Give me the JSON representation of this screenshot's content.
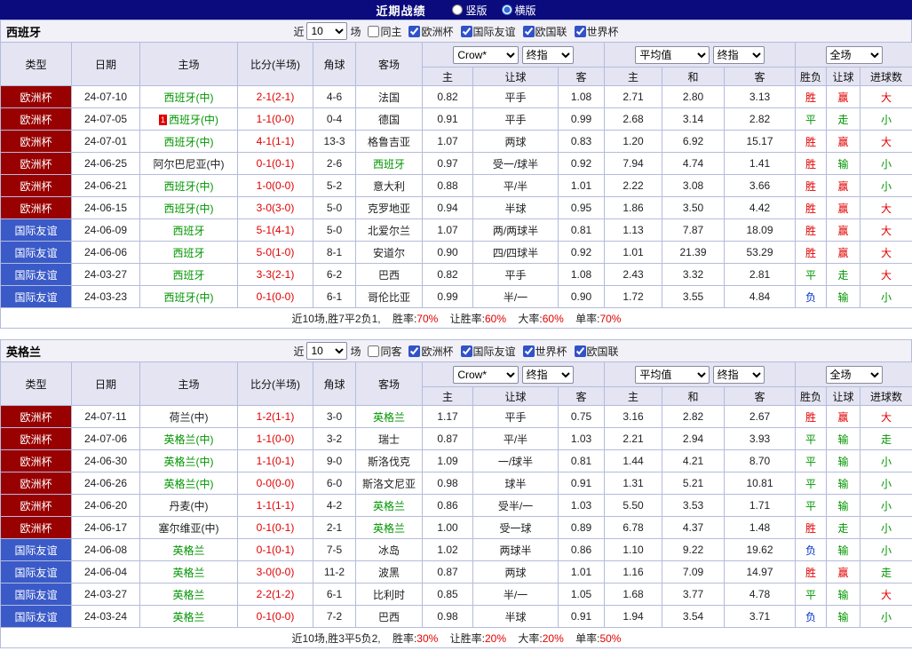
{
  "top_bar": {
    "title": "近期战绩",
    "options": [
      {
        "label": "竖版",
        "checked": false
      },
      {
        "label": "横版",
        "checked": true
      }
    ]
  },
  "colors": {
    "topbar_bg": "#0b0b7e",
    "euro_cup_bg": "#990000",
    "friendly_bg": "#3a5ac8",
    "header_bg": "#e4e4f2",
    "win_red": "#e00000",
    "draw_green": "#009500",
    "lose_blue": "#0033cc",
    "team_green": "#009500"
  },
  "header_labels": {
    "type": "类型",
    "date": "日期",
    "home": "主场",
    "score": "比分(半场)",
    "corner": "角球",
    "away": "客场",
    "crow": "Crow*",
    "final_index": "终指",
    "average": "平均值",
    "scope": "全场",
    "sub_home": "主",
    "sub_handicap": "让球",
    "sub_away": "客",
    "sub_draw": "和",
    "sub_result": "胜负",
    "sub_goals": "进球数"
  },
  "sections": [
    {
      "team": "西班牙",
      "filter": {
        "near": "近",
        "count": "10",
        "unit": "场",
        "same": {
          "label": "同主",
          "checked": false
        },
        "competitions": [
          {
            "label": "欧洲杯",
            "checked": true
          },
          {
            "label": "国际友谊",
            "checked": true
          },
          {
            "label": "欧国联",
            "checked": true
          },
          {
            "label": "世界杯",
            "checked": true
          }
        ]
      },
      "rows": [
        {
          "type": "欧洲杯",
          "type_style": "euro",
          "date": "24-07-10",
          "home": "西班牙(中)",
          "home_green": true,
          "red_card": false,
          "score": "2-1(2-1)",
          "corner": "4-6",
          "away": "法国",
          "away_green": false,
          "odds_home": "0.82",
          "handicap": "平手",
          "odds_away": "1.08",
          "avg_home": "2.71",
          "avg_draw": "2.80",
          "avg_away": "3.13",
          "result": "胜",
          "result_color": "red",
          "handicap_result": "赢",
          "handicap_result_color": "red",
          "goals": "大",
          "goals_color": "red"
        },
        {
          "type": "欧洲杯",
          "type_style": "euro",
          "date": "24-07-05",
          "home": "西班牙(中)",
          "home_green": true,
          "red_card": true,
          "score": "1-1(0-0)",
          "corner": "0-4",
          "away": "德国",
          "away_green": false,
          "odds_home": "0.91",
          "handicap": "平手",
          "odds_away": "0.99",
          "avg_home": "2.68",
          "avg_draw": "3.14",
          "avg_away": "2.82",
          "result": "平",
          "result_color": "green",
          "handicap_result": "走",
          "handicap_result_color": "green",
          "goals": "小",
          "goals_color": "green"
        },
        {
          "type": "欧洲杯",
          "type_style": "euro",
          "date": "24-07-01",
          "home": "西班牙(中)",
          "home_green": true,
          "red_card": false,
          "score": "4-1(1-1)",
          "corner": "13-3",
          "away": "格鲁吉亚",
          "away_green": false,
          "odds_home": "1.07",
          "handicap": "两球",
          "odds_away": "0.83",
          "avg_home": "1.20",
          "avg_draw": "6.92",
          "avg_away": "15.17",
          "result": "胜",
          "result_color": "red",
          "handicap_result": "赢",
          "handicap_result_color": "red",
          "goals": "大",
          "goals_color": "red"
        },
        {
          "type": "欧洲杯",
          "type_style": "euro",
          "date": "24-06-25",
          "home": "阿尔巴尼亚(中)",
          "home_green": false,
          "red_card": false,
          "score": "0-1(0-1)",
          "corner": "2-6",
          "away": "西班牙",
          "away_green": true,
          "odds_home": "0.97",
          "handicap": "受一/球半",
          "odds_away": "0.92",
          "avg_home": "7.94",
          "avg_draw": "4.74",
          "avg_away": "1.41",
          "result": "胜",
          "result_color": "red",
          "handicap_result": "输",
          "handicap_result_color": "green",
          "goals": "小",
          "goals_color": "green"
        },
        {
          "type": "欧洲杯",
          "type_style": "euro",
          "date": "24-06-21",
          "home": "西班牙(中)",
          "home_green": true,
          "red_card": false,
          "score": "1-0(0-0)",
          "corner": "5-2",
          "away": "意大利",
          "away_green": false,
          "odds_home": "0.88",
          "handicap": "平/半",
          "odds_away": "1.01",
          "avg_home": "2.22",
          "avg_draw": "3.08",
          "avg_away": "3.66",
          "result": "胜",
          "result_color": "red",
          "handicap_result": "赢",
          "handicap_result_color": "red",
          "goals": "小",
          "goals_color": "green"
        },
        {
          "type": "欧洲杯",
          "type_style": "euro",
          "date": "24-06-15",
          "home": "西班牙(中)",
          "home_green": true,
          "red_card": false,
          "score": "3-0(3-0)",
          "corner": "5-0",
          "away": "克罗地亚",
          "away_green": false,
          "odds_home": "0.94",
          "handicap": "半球",
          "odds_away": "0.95",
          "avg_home": "1.86",
          "avg_draw": "3.50",
          "avg_away": "4.42",
          "result": "胜",
          "result_color": "red",
          "handicap_result": "赢",
          "handicap_result_color": "red",
          "goals": "大",
          "goals_color": "red"
        },
        {
          "type": "国际友谊",
          "type_style": "friendly",
          "date": "24-06-09",
          "home": "西班牙",
          "home_green": true,
          "red_card": false,
          "score": "5-1(4-1)",
          "corner": "5-0",
          "away": "北爱尔兰",
          "away_green": false,
          "odds_home": "1.07",
          "handicap": "两/两球半",
          "odds_away": "0.81",
          "avg_home": "1.13",
          "avg_draw": "7.87",
          "avg_away": "18.09",
          "result": "胜",
          "result_color": "red",
          "handicap_result": "赢",
          "handicap_result_color": "red",
          "goals": "大",
          "goals_color": "red"
        },
        {
          "type": "国际友谊",
          "type_style": "friendly",
          "date": "24-06-06",
          "home": "西班牙",
          "home_green": true,
          "red_card": false,
          "score": "5-0(1-0)",
          "corner": "8-1",
          "away": "安道尔",
          "away_green": false,
          "odds_home": "0.90",
          "handicap": "四/四球半",
          "odds_away": "0.92",
          "avg_home": "1.01",
          "avg_draw": "21.39",
          "avg_away": "53.29",
          "result": "胜",
          "result_color": "red",
          "handicap_result": "赢",
          "handicap_result_color": "red",
          "goals": "大",
          "goals_color": "red"
        },
        {
          "type": "国际友谊",
          "type_style": "friendly",
          "date": "24-03-27",
          "home": "西班牙",
          "home_green": true,
          "red_card": false,
          "score": "3-3(2-1)",
          "corner": "6-2",
          "away": "巴西",
          "away_green": false,
          "odds_home": "0.82",
          "handicap": "平手",
          "odds_away": "1.08",
          "avg_home": "2.43",
          "avg_draw": "3.32",
          "avg_away": "2.81",
          "result": "平",
          "result_color": "green",
          "handicap_result": "走",
          "handicap_result_color": "green",
          "goals": "大",
          "goals_color": "red"
        },
        {
          "type": "国际友谊",
          "type_style": "friendly",
          "date": "24-03-23",
          "home": "西班牙(中)",
          "home_green": true,
          "red_card": false,
          "score": "0-1(0-0)",
          "corner": "6-1",
          "away": "哥伦比亚",
          "away_green": false,
          "odds_home": "0.99",
          "handicap": "半/一",
          "odds_away": "0.90",
          "avg_home": "1.72",
          "avg_draw": "3.55",
          "avg_away": "4.84",
          "result": "负",
          "result_color": "blue",
          "handicap_result": "输",
          "handicap_result_color": "green",
          "goals": "小",
          "goals_color": "green"
        }
      ],
      "summary": {
        "prefix": "近10场,胜7平2负1,",
        "stats": [
          {
            "label": "胜率:",
            "value": "70%"
          },
          {
            "label": "让胜率:",
            "value": "60%"
          },
          {
            "label": "大率:",
            "value": "60%"
          },
          {
            "label": "单率:",
            "value": "70%"
          }
        ]
      }
    },
    {
      "team": "英格兰",
      "filter": {
        "near": "近",
        "count": "10",
        "unit": "场",
        "same": {
          "label": "同客",
          "checked": false
        },
        "competitions": [
          {
            "label": "欧洲杯",
            "checked": true
          },
          {
            "label": "国际友谊",
            "checked": true
          },
          {
            "label": "世界杯",
            "checked": true
          },
          {
            "label": "欧国联",
            "checked": true
          }
        ]
      },
      "rows": [
        {
          "type": "欧洲杯",
          "type_style": "euro",
          "date": "24-07-11",
          "home": "荷兰(中)",
          "home_green": false,
          "red_card": false,
          "score": "1-2(1-1)",
          "corner": "3-0",
          "away": "英格兰",
          "away_green": true,
          "odds_home": "1.17",
          "handicap": "平手",
          "odds_away": "0.75",
          "avg_home": "3.16",
          "avg_draw": "2.82",
          "avg_away": "2.67",
          "result": "胜",
          "result_color": "red",
          "handicap_result": "赢",
          "handicap_result_color": "red",
          "goals": "大",
          "goals_color": "red"
        },
        {
          "type": "欧洲杯",
          "type_style": "euro",
          "date": "24-07-06",
          "home": "英格兰(中)",
          "home_green": true,
          "red_card": false,
          "score": "1-1(0-0)",
          "corner": "3-2",
          "away": "瑞士",
          "away_green": false,
          "odds_home": "0.87",
          "handicap": "平/半",
          "odds_away": "1.03",
          "avg_home": "2.21",
          "avg_draw": "2.94",
          "avg_away": "3.93",
          "result": "平",
          "result_color": "green",
          "handicap_result": "输",
          "handicap_result_color": "green",
          "goals": "走",
          "goals_color": "green"
        },
        {
          "type": "欧洲杯",
          "type_style": "euro",
          "date": "24-06-30",
          "home": "英格兰(中)",
          "home_green": true,
          "red_card": false,
          "score": "1-1(0-1)",
          "corner": "9-0",
          "away": "斯洛伐克",
          "away_green": false,
          "odds_home": "1.09",
          "handicap": "一/球半",
          "odds_away": "0.81",
          "avg_home": "1.44",
          "avg_draw": "4.21",
          "avg_away": "8.70",
          "result": "平",
          "result_color": "green",
          "handicap_result": "输",
          "handicap_result_color": "green",
          "goals": "小",
          "goals_color": "green"
        },
        {
          "type": "欧洲杯",
          "type_style": "euro",
          "date": "24-06-26",
          "home": "英格兰(中)",
          "home_green": true,
          "red_card": false,
          "score": "0-0(0-0)",
          "corner": "6-0",
          "away": "斯洛文尼亚",
          "away_green": false,
          "odds_home": "0.98",
          "handicap": "球半",
          "odds_away": "0.91",
          "avg_home": "1.31",
          "avg_draw": "5.21",
          "avg_away": "10.81",
          "result": "平",
          "result_color": "green",
          "handicap_result": "输",
          "handicap_result_color": "green",
          "goals": "小",
          "goals_color": "green"
        },
        {
          "type": "欧洲杯",
          "type_style": "euro",
          "date": "24-06-20",
          "home": "丹麦(中)",
          "home_green": false,
          "red_card": false,
          "score": "1-1(1-1)",
          "corner": "4-2",
          "away": "英格兰",
          "away_green": true,
          "odds_home": "0.86",
          "handicap": "受半/一",
          "odds_away": "1.03",
          "avg_home": "5.50",
          "avg_draw": "3.53",
          "avg_away": "1.71",
          "result": "平",
          "result_color": "green",
          "handicap_result": "输",
          "handicap_result_color": "green",
          "goals": "小",
          "goals_color": "green"
        },
        {
          "type": "欧洲杯",
          "type_style": "euro",
          "date": "24-06-17",
          "home": "塞尔维亚(中)",
          "home_green": false,
          "red_card": false,
          "score": "0-1(0-1)",
          "corner": "2-1",
          "away": "英格兰",
          "away_green": true,
          "odds_home": "1.00",
          "handicap": "受一球",
          "odds_away": "0.89",
          "avg_home": "6.78",
          "avg_draw": "4.37",
          "avg_away": "1.48",
          "result": "胜",
          "result_color": "red",
          "handicap_result": "走",
          "handicap_result_color": "green",
          "goals": "小",
          "goals_color": "green"
        },
        {
          "type": "国际友谊",
          "type_style": "friendly",
          "date": "24-06-08",
          "home": "英格兰",
          "home_green": true,
          "red_card": false,
          "score": "0-1(0-1)",
          "corner": "7-5",
          "away": "冰岛",
          "away_green": false,
          "odds_home": "1.02",
          "handicap": "两球半",
          "odds_away": "0.86",
          "avg_home": "1.10",
          "avg_draw": "9.22",
          "avg_away": "19.62",
          "result": "负",
          "result_color": "blue",
          "handicap_result": "输",
          "handicap_result_color": "green",
          "goals": "小",
          "goals_color": "green"
        },
        {
          "type": "国际友谊",
          "type_style": "friendly",
          "date": "24-06-04",
          "home": "英格兰",
          "home_green": true,
          "red_card": false,
          "score": "3-0(0-0)",
          "corner": "11-2",
          "away": "波黑",
          "away_green": false,
          "odds_home": "0.87",
          "handicap": "两球",
          "odds_away": "1.01",
          "avg_home": "1.16",
          "avg_draw": "7.09",
          "avg_away": "14.97",
          "result": "胜",
          "result_color": "red",
          "handicap_result": "赢",
          "handicap_result_color": "red",
          "goals": "走",
          "goals_color": "green"
        },
        {
          "type": "国际友谊",
          "type_style": "friendly",
          "date": "24-03-27",
          "home": "英格兰",
          "home_green": true,
          "red_card": false,
          "score": "2-2(1-2)",
          "corner": "6-1",
          "away": "比利时",
          "away_green": false,
          "odds_home": "0.85",
          "handicap": "半/一",
          "odds_away": "1.05",
          "avg_home": "1.68",
          "avg_draw": "3.77",
          "avg_away": "4.78",
          "result": "平",
          "result_color": "green",
          "handicap_result": "输",
          "handicap_result_color": "green",
          "goals": "大",
          "goals_color": "red"
        },
        {
          "type": "国际友谊",
          "type_style": "friendly",
          "date": "24-03-24",
          "home": "英格兰",
          "home_green": true,
          "red_card": false,
          "score": "0-1(0-0)",
          "corner": "7-2",
          "away": "巴西",
          "away_green": false,
          "odds_home": "0.98",
          "handicap": "半球",
          "odds_away": "0.91",
          "avg_home": "1.94",
          "avg_draw": "3.54",
          "avg_away": "3.71",
          "result": "负",
          "result_color": "blue",
          "handicap_result": "输",
          "handicap_result_color": "green",
          "goals": "小",
          "goals_color": "green"
        }
      ],
      "summary": {
        "prefix": "近10场,胜3平5负2,",
        "stats": [
          {
            "label": "胜率:",
            "value": "30%"
          },
          {
            "label": "让胜率:",
            "value": "20%"
          },
          {
            "label": "大率:",
            "value": "20%"
          },
          {
            "label": "单率:",
            "value": "50%"
          }
        ]
      }
    }
  ]
}
